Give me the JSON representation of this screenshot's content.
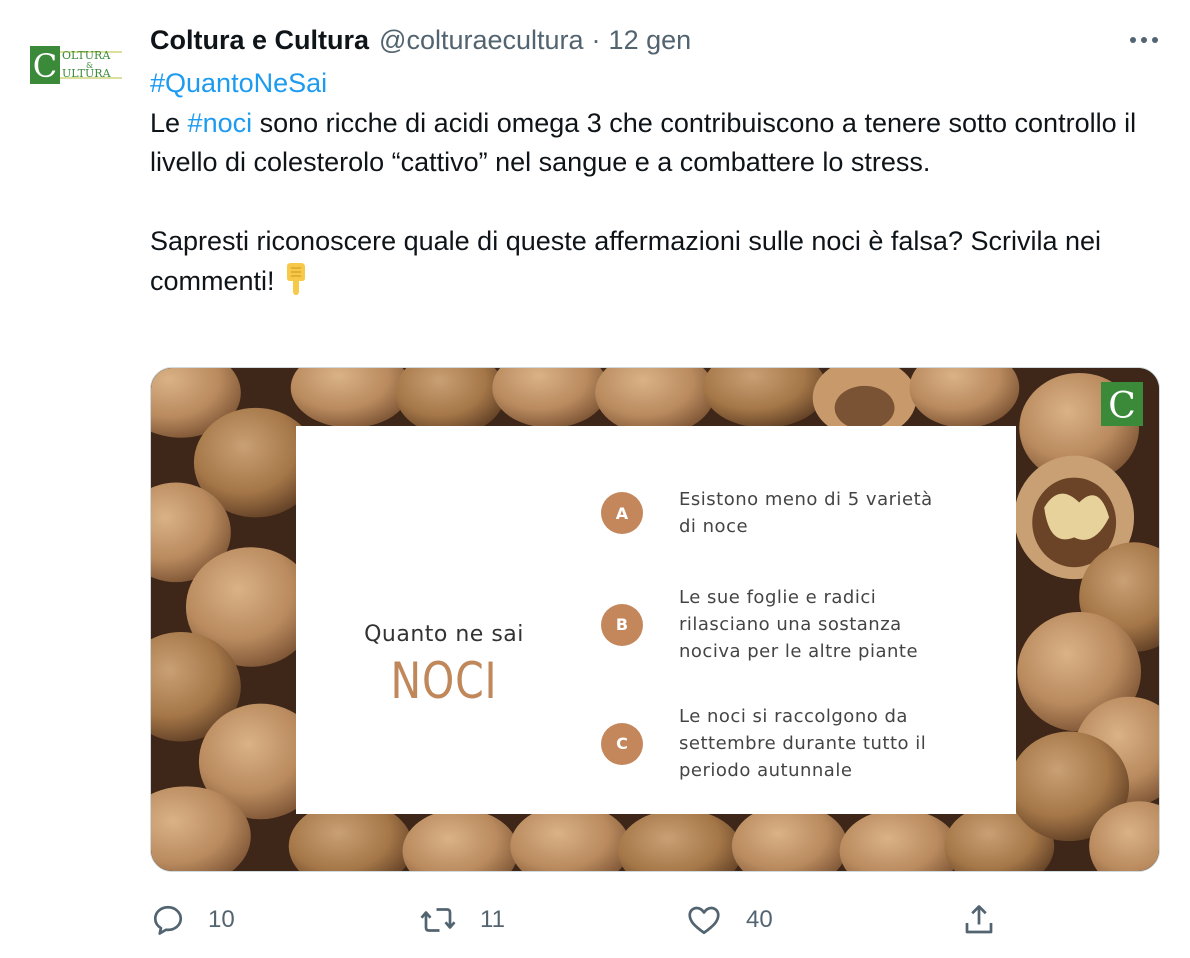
{
  "author": {
    "display_name": "Coltura e Cultura",
    "handle": "@colturaecultura",
    "separator": "·",
    "timestamp": "12 gen",
    "avatar_logo_lines": [
      "OLTURA",
      "&",
      "ULTURA"
    ],
    "avatar_logo_initial": "C"
  },
  "more_icon": "more-horizontal-icon",
  "tweet": {
    "hashtag_line": "#QuantoNeSai",
    "p1_prefix": "Le ",
    "p1_hashtag": "#noci",
    "p1_rest": " sono ricche di acidi omega 3 che contribuiscono a tenere sotto controllo il livello di colesterolo “cattivo” nel sangue e a combattere lo stress.",
    "p2": "Sapresti riconoscere quale di queste affermazioni sulle noci è falsa? Scrivila nei commenti!",
    "emoji": "👇"
  },
  "media": {
    "corner_logo_letter": "C",
    "quiz_title": "Quanto ne sai",
    "quiz_word": "NOCI",
    "options": [
      {
        "letter": "A",
        "text": "Esistono meno di 5 varietà\ndi noce"
      },
      {
        "letter": "B",
        "text": "Le sue foglie e radici\nrilasciano una sostanza\nnociva per le altre piante"
      },
      {
        "letter": "C",
        "text": "Le noci si raccolgono da\nsettembre durante tutto il\nperiodo autunnale"
      }
    ]
  },
  "actions": {
    "replies": "10",
    "retweets": "11",
    "likes": "40",
    "share": ""
  },
  "colors": {
    "hashtag": "#1d9bf0",
    "secondary_text": "#536471",
    "brand_green": "#3b8a3a",
    "option_circle": "#c4875c",
    "walnut_brown": "#b98a5e"
  }
}
